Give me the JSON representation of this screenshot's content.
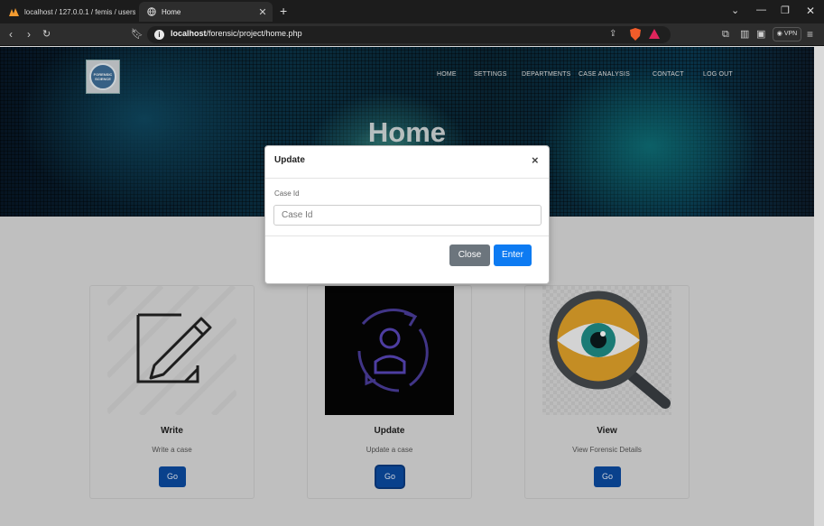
{
  "browser": {
    "tabs": [
      {
        "label": "localhost / 127.0.0.1 / femis / users",
        "active": false
      },
      {
        "label": "Home",
        "active": true
      }
    ],
    "new_tab_symbol": "+",
    "url_host": "localhost",
    "url_path": "/forensic/project/home.php",
    "vpn_label": "VPN",
    "accent_color": "#1c1c1c"
  },
  "site": {
    "logo_text": "FORENSIC SCIENCE",
    "nav": [
      "HOME",
      "SETTINGS",
      "DEPARTMENTS",
      "CASE ANALYSIS",
      "CONTACT",
      "LOG OUT"
    ],
    "hero_title": "Home"
  },
  "cards": [
    {
      "title": "Write",
      "description": "Write a case",
      "button": "Go",
      "icon": "pencil-paper-icon"
    },
    {
      "title": "Update",
      "description": "Update a case",
      "button": "Go",
      "icon": "user-refresh-icon"
    },
    {
      "title": "View",
      "description": "View Forensic Details",
      "button": "Go",
      "icon": "eye-magnifier-icon"
    }
  ],
  "modal": {
    "title": "Update",
    "close_symbol": "×",
    "field_label": "Case Id",
    "field_placeholder": "Case Id",
    "field_value": "",
    "close_button": "Close",
    "enter_button": "Enter",
    "primary_color": "#0d7bf2",
    "secondary_color": "#6c757d"
  }
}
